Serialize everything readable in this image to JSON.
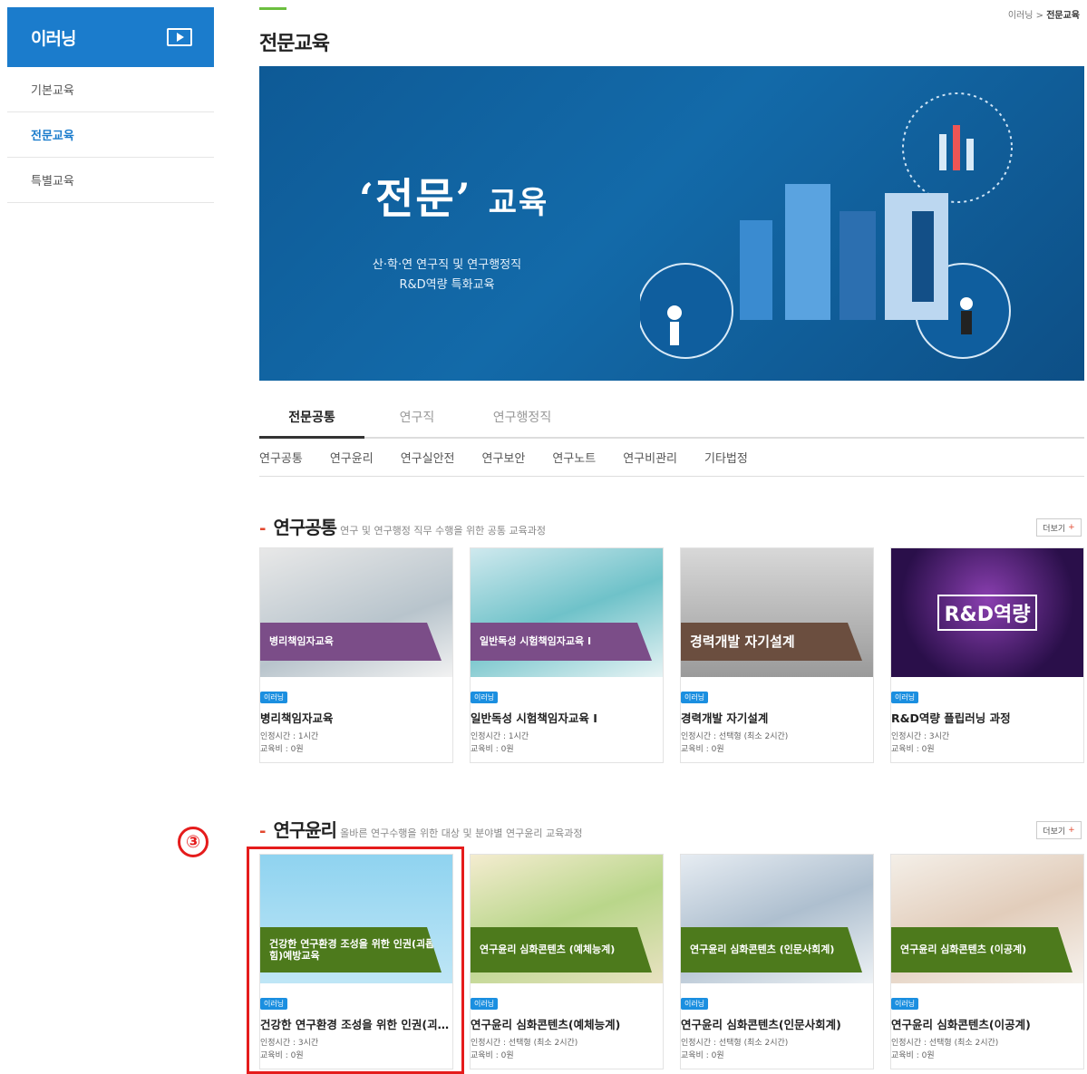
{
  "sidebar": {
    "title": "이러닝",
    "items": [
      {
        "label": "기본교육",
        "active": false
      },
      {
        "label": "전문교육",
        "active": true
      },
      {
        "label": "특별교육",
        "active": false
      }
    ]
  },
  "breadcrumb": {
    "parent": "이러닝",
    "separator": ">",
    "current": "전문교육"
  },
  "page_title": "전문교육",
  "banner": {
    "headline_main": "‘전문’",
    "headline_suffix": "교육",
    "subtitle_line1": "산·학·연 연구직 및 연구행정직",
    "subtitle_line2": "R&D역량 특화교육"
  },
  "tabs": [
    {
      "label": "전문공통",
      "active": true
    },
    {
      "label": "연구직",
      "active": false
    },
    {
      "label": "연구행정직",
      "active": false
    }
  ],
  "subtabs": [
    "연구공통",
    "연구윤리",
    "연구실안전",
    "연구보안",
    "연구노트",
    "연구비관리",
    "기타법정"
  ],
  "sections": [
    {
      "title": "연구공통",
      "desc": "연구 및 연구행정 직무 수행을 위한 공통 교육과정",
      "more": "더보기",
      "cards": [
        {
          "ribbon": "병리책임자교육",
          "badge": "이러닝",
          "title": "병리책임자교육",
          "meta1": "인정시간 : 1시간",
          "meta2": "교육비 : 0원"
        },
        {
          "ribbon": "일반독성 시험책임자교육 I",
          "badge": "이러닝",
          "title": "일반독성 시험책임자교육 I",
          "meta1": "인정시간 : 1시간",
          "meta2": "교육비 : 0원"
        },
        {
          "ribbon": "경력개발 자기설계",
          "badge": "이러닝",
          "title": "경력개발 자기설계",
          "meta1": "인정시간 : 선택형 (최소 2시간)",
          "meta2": "교육비 : 0원"
        },
        {
          "ribbon": "R&D역량",
          "badge": "이러닝",
          "title": "R&D역량 플립러닝 과정",
          "meta1": "인정시간 : 3시간",
          "meta2": "교육비 : 0원"
        }
      ]
    },
    {
      "title": "연구윤리",
      "desc": "올바른 연구수행을 위한 대상 및 분야별 연구윤리 교육과정",
      "more": "더보기",
      "cards": [
        {
          "ribbon": "건강한 연구환경 조성을 위한 인권(괴롭힘)예방교육",
          "badge": "이러닝",
          "title": "건강한 연구환경 조성을 위한 인권(괴롭힘)예방교육",
          "meta1": "인정시간 : 3시간",
          "meta2": "교육비 : 0원"
        },
        {
          "ribbon": "연구윤리 심화콘텐츠 (예체능계)",
          "badge": "이러닝",
          "title": "연구윤리 심화콘텐츠(예체능계)",
          "meta1": "인정시간 : 선택형 (최소 2시간)",
          "meta2": "교육비 : 0원"
        },
        {
          "ribbon": "연구윤리 심화콘텐츠 (인문사회계)",
          "badge": "이러닝",
          "title": "연구윤리 심화콘텐츠(인문사회계)",
          "meta1": "인정시간 : 선택형 (최소 2시간)",
          "meta2": "교육비 : 0원"
        },
        {
          "ribbon": "연구윤리 심화콘텐츠 (이공계)",
          "badge": "이러닝",
          "title": "연구윤리 심화콘텐츠(이공계)",
          "meta1": "인정시간 : 선택형 (최소 2시간)",
          "meta2": "교육비 : 0원"
        }
      ]
    }
  ],
  "annotation": {
    "marker": "③",
    "color": "#e51c1c"
  },
  "colors": {
    "primary": "#1b7ccc",
    "accent_green": "#6cbf3f",
    "dash_red": "#e2482f",
    "badge_blue": "#1b8fe0"
  }
}
